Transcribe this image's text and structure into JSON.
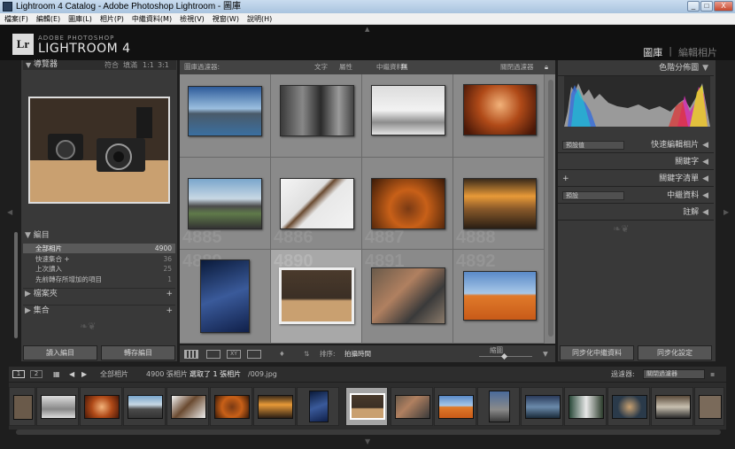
{
  "window": {
    "title": "Lightroom 4 Catalog - Adobe Photoshop Lightroom - 圖庫",
    "controls": [
      "_",
      "□",
      "X"
    ]
  },
  "menu": [
    "檔案(F)",
    "編輯(E)",
    "圖庫(L)",
    "相片(P)",
    "中繼資料(M)",
    "檢視(V)",
    "視窗(W)",
    "說明(H)"
  ],
  "brand": {
    "logo": "Lr",
    "line1": "ADOBE PHOTOSHOP",
    "line2": "LIGHTROOM 4"
  },
  "modules": {
    "active": "圖庫",
    "sep": "|",
    "other": "編輯相片"
  },
  "left": {
    "navigator": {
      "title": "導覽器",
      "zoom": [
        "符合",
        "填滿",
        "1:1",
        "3:1"
      ]
    },
    "catalog": {
      "title": "編目",
      "items": [
        {
          "label": "全部相片",
          "count": "4900"
        },
        {
          "label": "快速集合 +",
          "count": "36"
        },
        {
          "label": "上次讀入",
          "count": "25"
        },
        {
          "label": "先前轉存所增加的項目",
          "count": "1"
        }
      ]
    },
    "folders": {
      "title": "檔案夾",
      "plus": "+"
    },
    "collections": {
      "title": "集合",
      "plus": "+"
    },
    "import_btn": "讀入編目",
    "export_btn": "轉存編目"
  },
  "filter": {
    "label": "圖庫過濾器:",
    "options": [
      "文字",
      "屬性",
      "中繼資料",
      "無"
    ],
    "off": "關閉過濾器"
  },
  "grid": {
    "cell_numbers": [
      "4885",
      "4886",
      "4887",
      "4888",
      "4889",
      "4890",
      "4891",
      "4892"
    ]
  },
  "toolbar": {
    "sort_label": "排序:",
    "sort_value": "拍攝時間",
    "thumbs_label": "縮圖"
  },
  "right": {
    "histogram": "色階分佈圖",
    "quick_develop": {
      "preset": "預設值",
      "title": "快速編輯相片"
    },
    "keywording": "關鍵字",
    "keyword_list": {
      "plus": "+",
      "title": "關鍵字清單"
    },
    "metadata": {
      "preset": "預設",
      "title": "中繼資料"
    },
    "comments": "註解",
    "sync_metadata": "同步化中繼資料",
    "sync_settings": "同步化設定"
  },
  "filmstrip": {
    "pages": [
      "1",
      "2"
    ],
    "source": "全部相片",
    "count_text": "4900 張相片 /",
    "selected_text": "選取了 1 張相片",
    "file": "/009.jpg",
    "filter_label": "過濾器:",
    "filter_value": "關閉過濾器"
  },
  "colors": {
    "accent": "#e8e8e8",
    "panel": "#393939",
    "grid": "#7f7f7f"
  }
}
